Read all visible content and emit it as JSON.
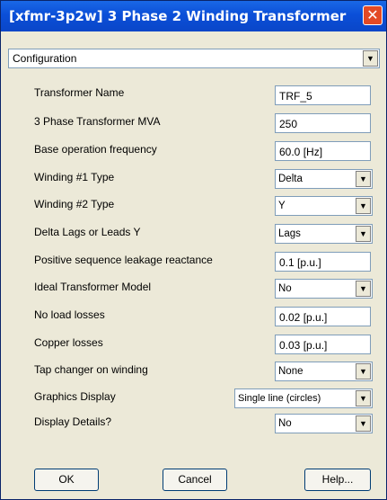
{
  "window": {
    "title": "[xfmr-3p2w] 3 Phase 2 Winding Transformer"
  },
  "category": {
    "value": "Configuration"
  },
  "fields": {
    "transformer_name": {
      "label": "Transformer Name",
      "value": "TRF_5"
    },
    "mva": {
      "label": "3 Phase Transformer MVA",
      "value": "250"
    },
    "frequency": {
      "label": "Base operation frequency",
      "value": "60.0 [Hz]"
    },
    "winding1": {
      "label": "Winding #1 Type",
      "value": "Delta"
    },
    "winding2": {
      "label": "Winding #2 Type",
      "value": "Y"
    },
    "delta_lags": {
      "label": "Delta Lags or Leads Y",
      "value": "Lags"
    },
    "leakage": {
      "label": "Positive sequence leakage reactance",
      "value": "0.1 [p.u.]"
    },
    "ideal_model": {
      "label": "Ideal Transformer Model",
      "value": "No"
    },
    "no_load_losses": {
      "label": "No load losses",
      "value": "0.02 [p.u.]"
    },
    "copper_losses": {
      "label": "Copper losses",
      "value": "0.03 [p.u.]"
    },
    "tap_changer": {
      "label": "Tap changer on winding",
      "value": "None"
    },
    "graphics_display": {
      "label": "Graphics Display",
      "value": "Single line (circles)"
    },
    "display_details": {
      "label": "Display Details?",
      "value": "No"
    }
  },
  "buttons": {
    "ok": "OK",
    "cancel": "Cancel",
    "help": "Help..."
  },
  "icons": {
    "close": "✕",
    "dropdown": "▼"
  },
  "colors": {
    "titlebar": "#0b4fd8",
    "close": "#e34a25",
    "dialog_bg": "#ece9d8"
  }
}
